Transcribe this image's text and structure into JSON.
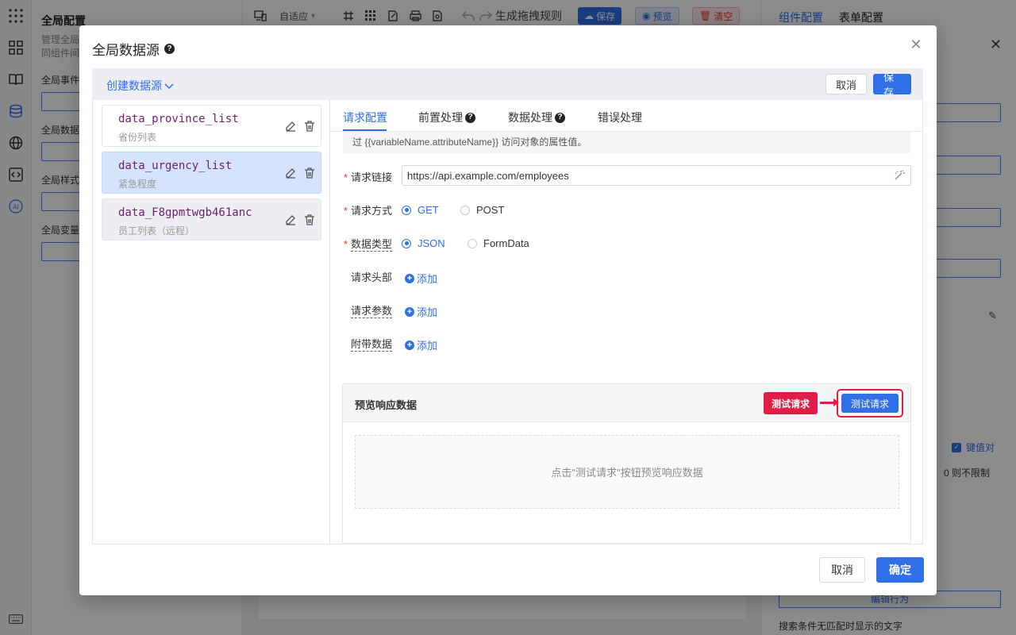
{
  "background": {
    "left_panel": {
      "title": "全局配置",
      "desc_line1": "管理全局",
      "desc_line2": "同组件间",
      "section_events": "全局事件",
      "section_data": "全局数据",
      "section_style": "全局样式",
      "section_vars": "全局变量"
    },
    "toolbar": {
      "adaptive": "自适应",
      "drag_rules": "生成拖拽规则",
      "save": "保存",
      "preview": "预览",
      "clear": "清空"
    },
    "right_panel": {
      "tab_component": "组件配置",
      "tab_form": "表单配置",
      "key_value_label": "键值对",
      "limit_hint": "0 则不限制",
      "edit_behavior": "编辑行为",
      "no_match_text": "搜索条件无匹配时显示的文字"
    }
  },
  "modal": {
    "title": "全局数据源",
    "create_datasource": "创建数据源",
    "header_cancel": "取消",
    "header_save": "保存",
    "datasources": [
      {
        "name": "data_province_list",
        "desc": "省份列表"
      },
      {
        "name": "data_urgency_list",
        "desc": "紧急程度"
      },
      {
        "name": "data_F8gpmtwgb461anc",
        "desc": "员工列表（远程）"
      }
    ],
    "tabs": [
      {
        "label": "请求配置"
      },
      {
        "label": "前置处理"
      },
      {
        "label": "数据处理"
      },
      {
        "label": "错误处理"
      }
    ],
    "tip_text": "过 {{variableName.attributeName}} 访问对象的属性值。",
    "form": {
      "url_label": "请求链接",
      "url_value": "https://api.example.com/employees",
      "method_label": "请求方式",
      "method_options": [
        "GET",
        "POST"
      ],
      "method_selected": "GET",
      "datatype_label": "数据类型",
      "datatype_options": [
        "JSON",
        "FormData"
      ],
      "datatype_selected": "JSON",
      "headers_label": "请求头部",
      "params_label": "请求参数",
      "extra_label": "附带数据",
      "add_label": "添加"
    },
    "preview": {
      "title": "预览响应数据",
      "callout": "测试请求",
      "test_button": "测试请求",
      "empty_text": "点击\"测试请求\"按钮预览响应数据"
    },
    "footer": {
      "cancel": "取消",
      "ok": "确定"
    }
  },
  "colors": {
    "primary": "#2f6fe8",
    "highlight": "#e11d48",
    "active_item": "#d5e3fc"
  }
}
